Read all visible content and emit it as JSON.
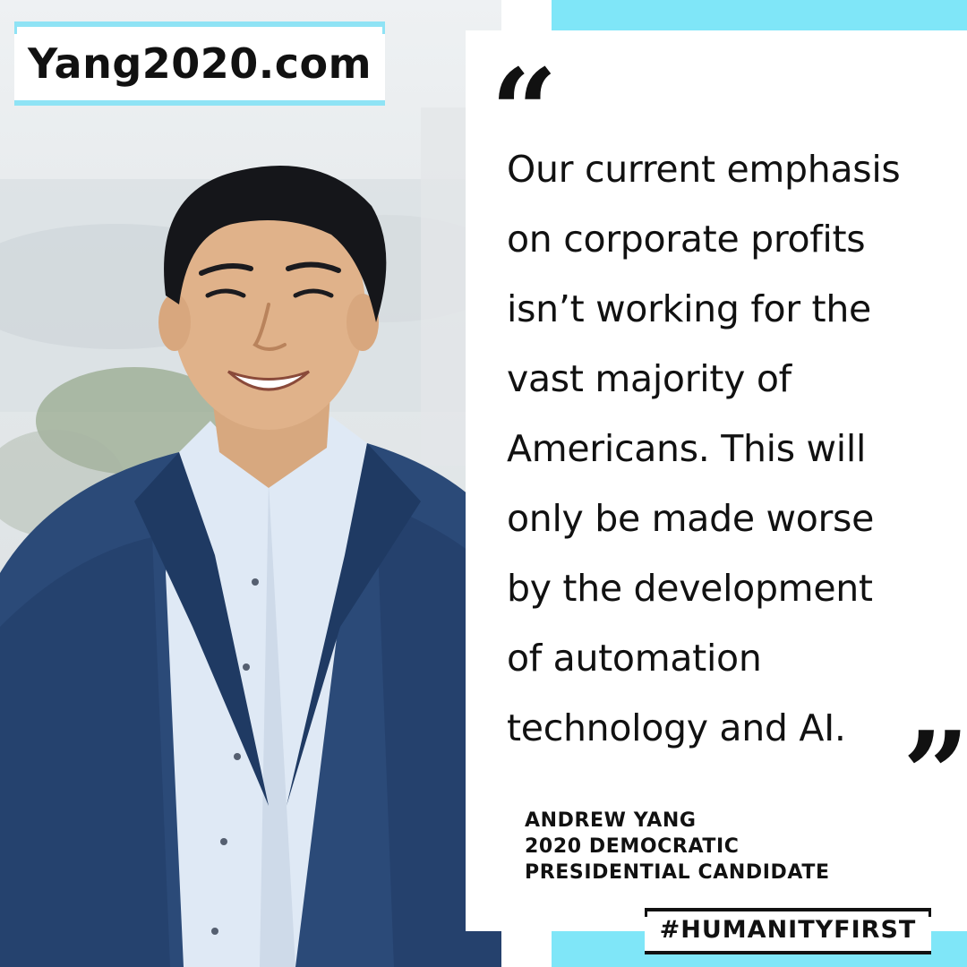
{
  "website": {
    "label": "Yang2020.com"
  },
  "quote": {
    "open_mark": "“",
    "close_mark": "”",
    "lines": [
      "Our current emphasis",
      "on corporate profits",
      "isn’t working for the",
      "vast majority of",
      "Americans. This will",
      "only be made worse",
      "by the development",
      "of automation",
      "technology and AI."
    ]
  },
  "attribution": {
    "name": "ANDREW YANG",
    "title_line1": "2020 DEMOCRATIC",
    "title_line2": "PRESIDENTIAL CANDIDATE"
  },
  "hashtag": {
    "label": "#HUMANITYFIRST"
  },
  "colors": {
    "accent": "#7fe6f8",
    "text": "#111111",
    "suit": "#2b4a78",
    "shirt": "#dfe9f5"
  }
}
